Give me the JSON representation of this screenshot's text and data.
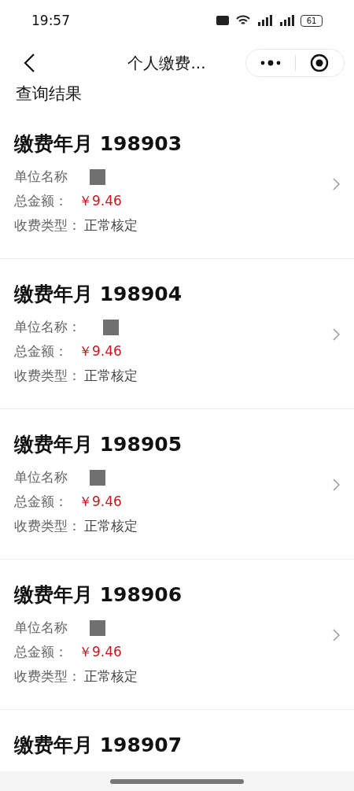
{
  "status_bar": {
    "time": "19:57",
    "battery": "61"
  },
  "nav_bar": {
    "title": "个人缴费..."
  },
  "section_title": "查询结果",
  "records": [
    {
      "title": "缴费年月 198903",
      "unit_label": "单位名称",
      "amount_label": "总金额：",
      "amount": "￥9.46",
      "type_label": "收费类型：",
      "type": "正常核定",
      "redacted": true
    },
    {
      "title": "缴费年月 198904",
      "unit_label": "单位名称：",
      "amount_label": "总金额：",
      "amount": "￥9.46",
      "type_label": "收费类型：",
      "type": "正常核定",
      "redacted": true
    },
    {
      "title": "缴费年月 198905",
      "unit_label": "单位名称",
      "amount_label": "总金额：",
      "amount": "￥9.46",
      "type_label": "收费类型：",
      "type": "正常核定",
      "redacted": true
    },
    {
      "title": "缴费年月 198906",
      "unit_label": "单位名称",
      "amount_label": "总金额：",
      "amount": "￥9.46",
      "type_label": "收费类型：",
      "type": "正常核定",
      "redacted": true
    },
    {
      "title": "缴费年月 198907"
    }
  ]
}
